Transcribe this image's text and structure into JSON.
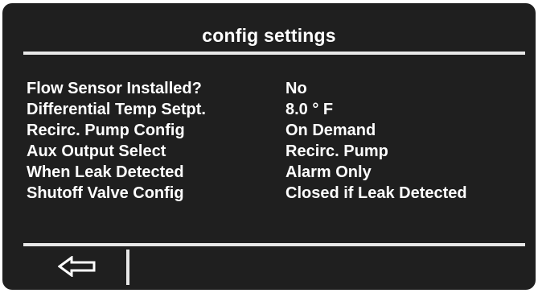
{
  "header": {
    "title": "config settings"
  },
  "settings": [
    {
      "label": "Flow Sensor Installed?",
      "value": "No"
    },
    {
      "label": "Differential Temp Setpt.",
      "value": "8.0 ° F"
    },
    {
      "label": "Recirc. Pump Config",
      "value": "On Demand"
    },
    {
      "label": "Aux Output Select",
      "value": "Recirc. Pump"
    },
    {
      "label": "When Leak Detected",
      "value": "Alarm Only"
    },
    {
      "label": "Shutoff Valve Config",
      "value": "Closed if Leak Detected"
    }
  ],
  "footer": {
    "back_icon": "left-arrow-icon"
  },
  "colors": {
    "background": "#1f1f1f",
    "text": "#ffffff",
    "rule": "#e8e8e8"
  }
}
